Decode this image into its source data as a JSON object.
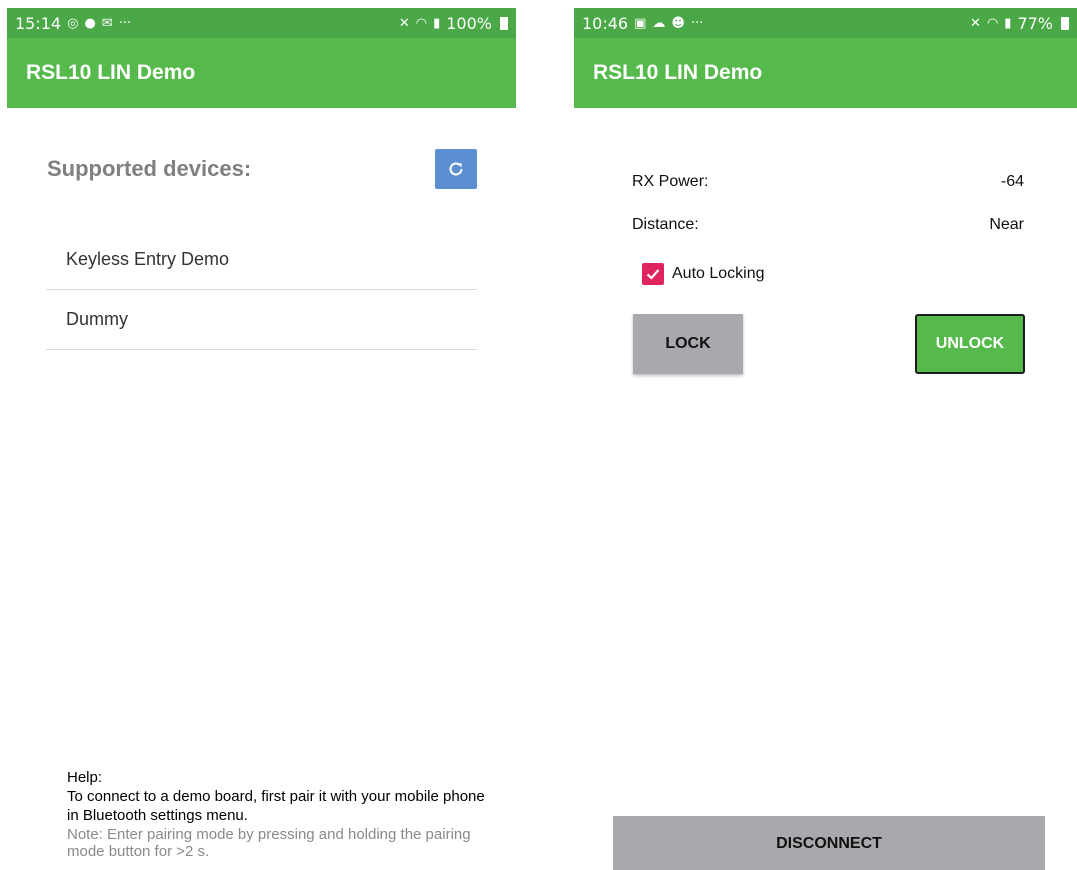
{
  "left_screen": {
    "statusbar": {
      "time": "15:14",
      "battery": "100%",
      "more_icon": "···"
    },
    "app_title": "RSL10 LIN Demo",
    "section_title": "Supported devices:",
    "devices": [
      {
        "label": "Keyless Entry Demo"
      },
      {
        "label": "Dummy"
      }
    ],
    "help": {
      "heading": "Help:",
      "text": "To connect to a demo board, first pair it with your mobile phone in Bluetooth settings menu.",
      "note": "Note: Enter pairing mode by pressing and holding the pairing mode button for >2 s."
    }
  },
  "right_screen": {
    "statusbar": {
      "time": "10:46",
      "battery": "77%",
      "more_icon": "···"
    },
    "app_title": "RSL10 LIN Demo",
    "rx_power": {
      "label": "RX Power:",
      "value": "-64"
    },
    "distance": {
      "label": "Distance:",
      "value": "Near"
    },
    "auto_locking": {
      "label": "Auto Locking",
      "checked": true
    },
    "lock_label": "LOCK",
    "unlock_label": "UNLOCK",
    "disconnect_label": "DISCONNECT"
  },
  "colors": {
    "statusbar": "#4aa847",
    "appbar": "#56b94b",
    "refresh_button": "#5b8fd1",
    "checkbox": "#e0245e",
    "gray_button": "#a9a9ad"
  }
}
